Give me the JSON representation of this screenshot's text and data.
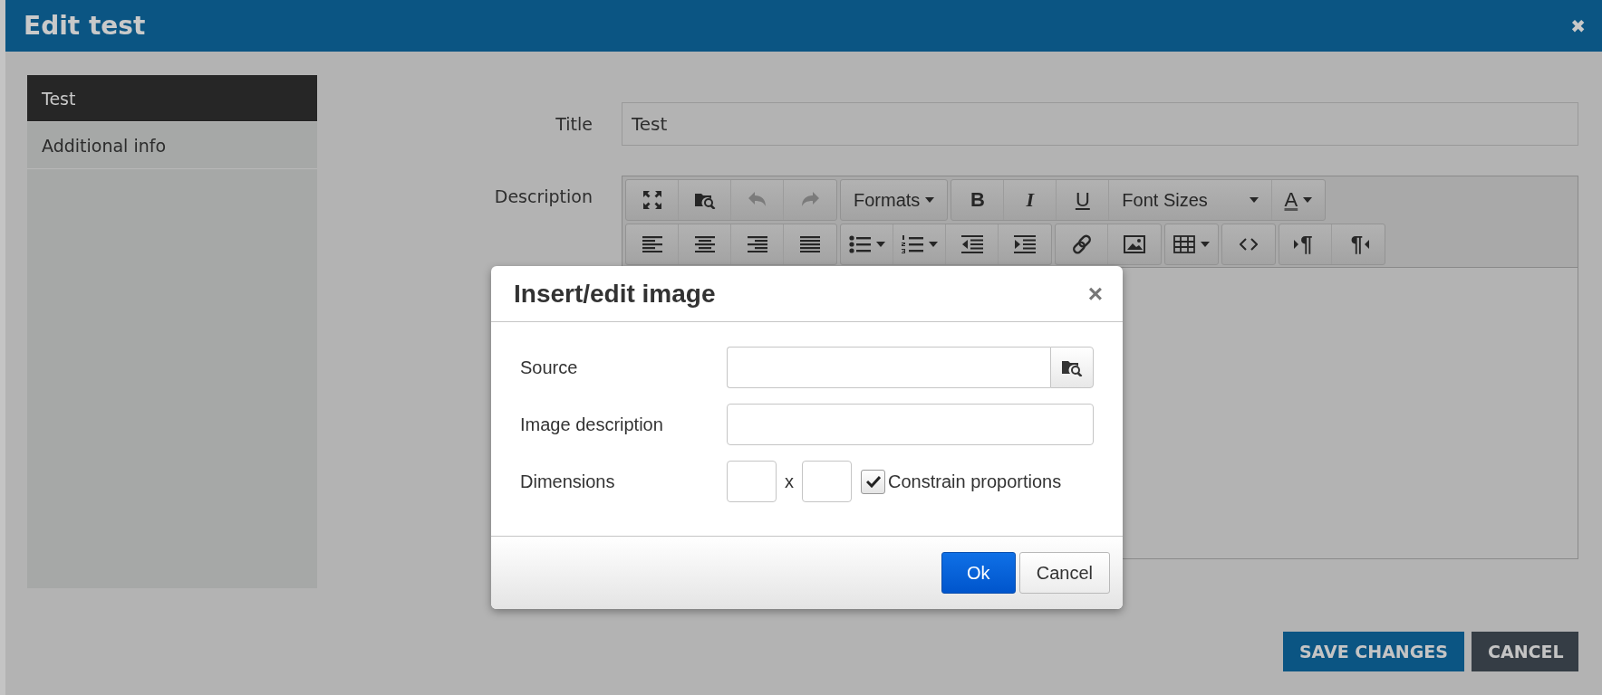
{
  "window": {
    "title": "Edit test",
    "close": "✖"
  },
  "sidebar": {
    "items": [
      {
        "label": "Test",
        "selected": true
      },
      {
        "label": "Additional info",
        "selected": false
      }
    ]
  },
  "form": {
    "title_field": {
      "label": "Title",
      "value": "Test"
    },
    "description": {
      "label": "Description"
    }
  },
  "editor_toolbar": {
    "rows": [
      [
        [
          {
            "kind": "fullscreen",
            "disabled": false
          },
          {
            "kind": "browse",
            "disabled": false
          },
          {
            "kind": "undo",
            "disabled": true
          },
          {
            "kind": "redo",
            "disabled": true
          }
        ],
        [
          {
            "kind": "menu",
            "label": "Formats",
            "dropdown": true,
            "disabled": false
          }
        ],
        [
          {
            "kind": "bold",
            "label": "B",
            "disabled": false
          },
          {
            "kind": "italic",
            "label": "I",
            "disabled": false
          },
          {
            "kind": "underline",
            "label": "U",
            "disabled": false
          },
          {
            "kind": "menu",
            "label": "Font Sizes",
            "dropdown": true,
            "disabled": false
          },
          {
            "kind": "forecolor",
            "label": "A",
            "dropdown": true,
            "disabled": false
          }
        ]
      ],
      [
        [
          {
            "kind": "align-left",
            "disabled": false
          },
          {
            "kind": "align-center",
            "disabled": false
          },
          {
            "kind": "align-right",
            "disabled": false
          },
          {
            "kind": "justify",
            "disabled": false
          }
        ],
        [
          {
            "kind": "bullist",
            "dropdown": true,
            "disabled": false
          },
          {
            "kind": "numlist",
            "dropdown": true,
            "disabled": false
          },
          {
            "kind": "outdent",
            "disabled": false
          },
          {
            "kind": "indent",
            "disabled": false
          }
        ],
        [
          {
            "kind": "link",
            "disabled": false
          },
          {
            "kind": "image",
            "disabled": false
          }
        ],
        [
          {
            "kind": "table",
            "dropdown": true,
            "disabled": false
          }
        ],
        [
          {
            "kind": "code",
            "disabled": false
          }
        ],
        [
          {
            "kind": "ltr",
            "label": "¶",
            "disabled": false
          },
          {
            "kind": "rtl",
            "label": "¶",
            "disabled": false
          }
        ]
      ]
    ]
  },
  "footer_buttons": [
    {
      "label": "SAVE CHANGES",
      "kind": "primary"
    },
    {
      "label": "CANCEL",
      "kind": "secondary"
    }
  ],
  "dialog": {
    "title": "Insert/edit image",
    "close": "×",
    "fields": [
      {
        "kind": "browse",
        "label": "Source"
      },
      {
        "kind": "text",
        "label": "Image description"
      },
      {
        "kind": "dimensions",
        "label": "Dimensions",
        "separator": "x",
        "checkbox": {
          "label": "Constrain proportions",
          "checked": true
        }
      }
    ],
    "buttons": [
      {
        "label": "Ok",
        "primary": true
      },
      {
        "label": "Cancel",
        "primary": false
      }
    ]
  }
}
